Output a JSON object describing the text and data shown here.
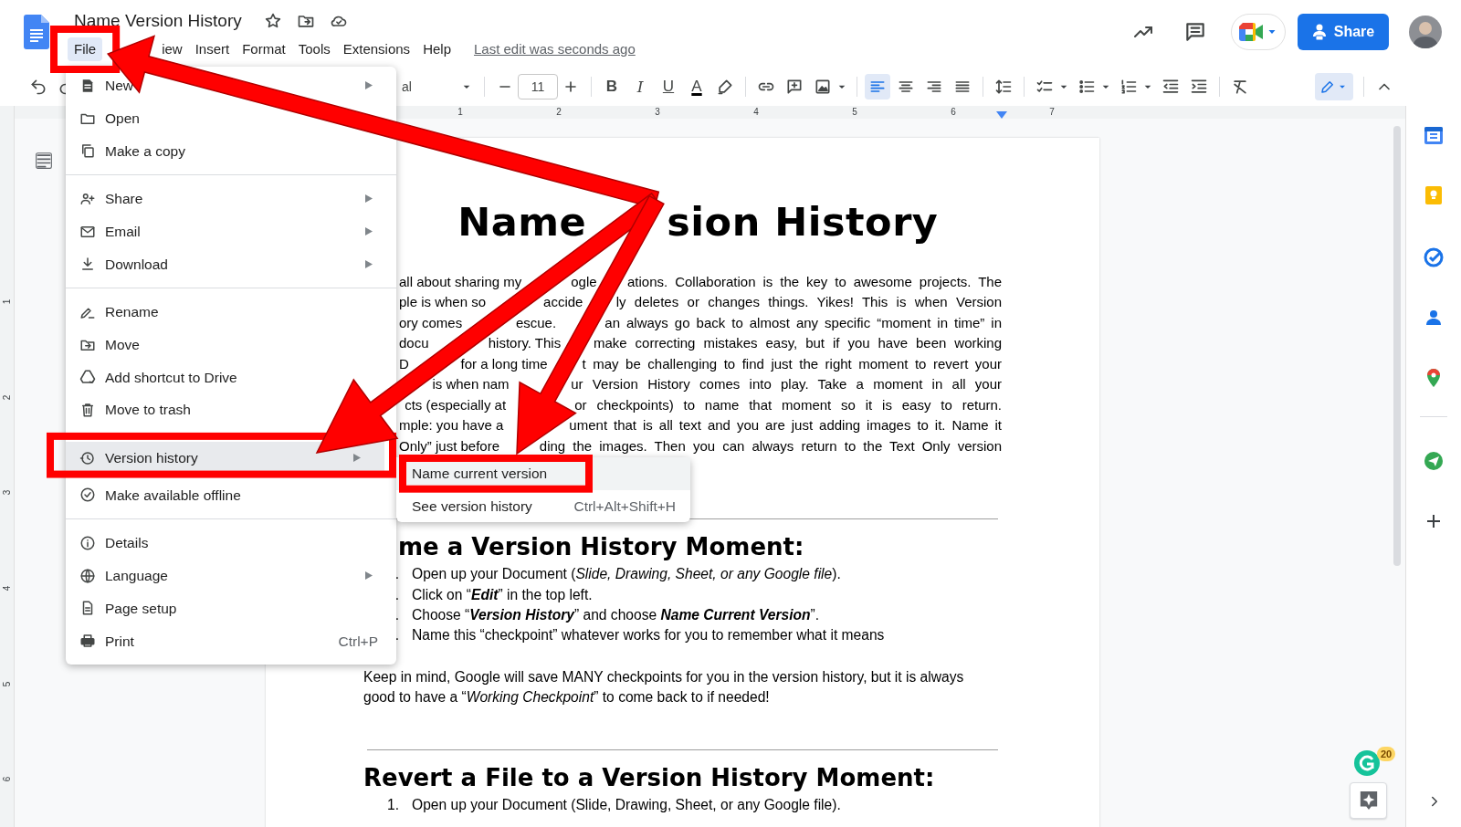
{
  "doc_title": "Name Version History",
  "menubar": [
    {
      "label": "File",
      "selected": true,
      "annotated": true
    },
    {
      "label": "iew",
      "selected": false,
      "annotated": false
    },
    {
      "label": "Insert",
      "selected": false,
      "annotated": false
    },
    {
      "label": "Format",
      "selected": false,
      "annotated": false
    },
    {
      "label": "Tools",
      "selected": false,
      "annotated": false
    },
    {
      "label": "Extensions",
      "selected": false,
      "annotated": false
    },
    {
      "label": "Help",
      "selected": false,
      "annotated": false
    }
  ],
  "last_edit": "Last edit was seconds ago",
  "share_label": "Share",
  "toolbar": {
    "font": "al",
    "font_size": "11",
    "format_glyphs": [
      "B",
      "I",
      "U",
      "A"
    ],
    "align": [
      {
        "selected": true
      },
      {
        "selected": false
      },
      {
        "selected": false
      },
      {
        "selected": false
      }
    ]
  },
  "ruler": [
    "1",
    "2",
    "3",
    "4",
    "5",
    "6",
    "7"
  ],
  "side_ruler": [
    "1",
    "2",
    "3",
    "4",
    "5",
    "6"
  ],
  "file_menu": [
    [
      {
        "label": "New",
        "submenu": true,
        "highlighted": false,
        "annotated": false
      },
      {
        "label": "Open",
        "highlighted": false,
        "annotated": false
      },
      {
        "label": "Make a copy",
        "submenu": false,
        "highlighted": false,
        "annotated": false
      }
    ],
    [
      {
        "label": "Share",
        "submenu": true,
        "highlighted": false,
        "annotated": false
      },
      {
        "label": "Email",
        "submenu": true,
        "highlighted": false,
        "annotated": false
      },
      {
        "label": "Download",
        "submenu": true,
        "highlighted": false,
        "annotated": false
      }
    ],
    [
      {
        "label": "Rename",
        "submenu": false,
        "highlighted": false,
        "annotated": false
      },
      {
        "label": "Move",
        "submenu": false,
        "highlighted": false,
        "annotated": false
      },
      {
        "label": "Add shortcut to Drive",
        "submenu": false,
        "highlighted": false,
        "annotated": false
      },
      {
        "label": "Move to trash",
        "highlighted": false,
        "annotated": false
      }
    ],
    [
      {
        "label": "Version history",
        "submenu": true,
        "highlighted": true,
        "annotated": true
      },
      {
        "label": "Make available offline",
        "submenu": false,
        "highlighted": false,
        "annotated": false
      }
    ],
    [
      {
        "label": "Details",
        "submenu": false,
        "highlighted": false,
        "annotated": false
      },
      {
        "label": "Language",
        "submenu": true,
        "highlighted": false,
        "annotated": false
      },
      {
        "label": "Page setup",
        "submenu": false,
        "highlighted": false,
        "annotated": false
      },
      {
        "label": "Print",
        "shortcut": "Ctrl+P",
        "submenu": false,
        "highlighted": false,
        "annotated": false
      }
    ]
  ],
  "submenu": [
    {
      "label": "Name current version",
      "highlighted": true,
      "annotated": true
    },
    {
      "label": "See version history",
      "shortcut": "Ctrl+Alt+Shift+H",
      "highlighted": false,
      "annotated": false
    }
  ],
  "document": {
    "title_segments": [
      "Name",
      "sion History"
    ],
    "intro_lines": [
      [
        "all about sharing my",
        "ogle",
        "ations. Collaboration is the key to awesome projects. The"
      ],
      [
        "ple is when so",
        "accide",
        "ly deletes or changes things. Yikes! This is when Version"
      ],
      [
        "ory comes",
        "escue.",
        "an always go back to almost any specific “moment in time” in"
      ],
      [
        "docu",
        "history. This",
        "make correcting mistakes easy, but if you have been working"
      ],
      [
        "D",
        "for a long time",
        "t may be challenging to find just the right moment to revert your"
      ],
      [
        "is when nam",
        "ur Version History comes into play. Take a moment in all your"
      ],
      [
        "cts (especially at",
        "or checkpoints) to name that moment so it is easy to return."
      ],
      [
        "mple: you have a",
        "ument that is all text and you are just adding images to it. Name it"
      ],
      [
        "Only” just before",
        "ding the images. Then you can always return to the Text Only version"
      ]
    ],
    "sections": [
      {
        "heading": "me a Version History Moment:",
        "items": [
          {
            "marker": ".",
            "text": "Open up your Document (*Slide, Drawing, Sheet, or any Google file*)."
          },
          {
            "marker": ".",
            "text": "Click on “**Edit**” in the top left."
          },
          {
            "marker": ".",
            "text": "Choose “**Version History**” and choose **Name Current Version**”."
          },
          {
            "marker": ".",
            "text": "Name this “checkpoint” whatever works for you to remember what it means"
          }
        ],
        "note": "Keep in mind, Google will save MANY checkpoints for you in the version history, but it is always good to have a “*Working Checkpoint*” to come back to if needed!"
      },
      {
        "heading": "Revert a File to a Version History Moment:",
        "items": [
          {
            "marker": "1.",
            "text": "Open up your Document (Slide, Drawing, Sheet, or any Google file)."
          }
        ]
      }
    ]
  },
  "grammarly_count": "20"
}
